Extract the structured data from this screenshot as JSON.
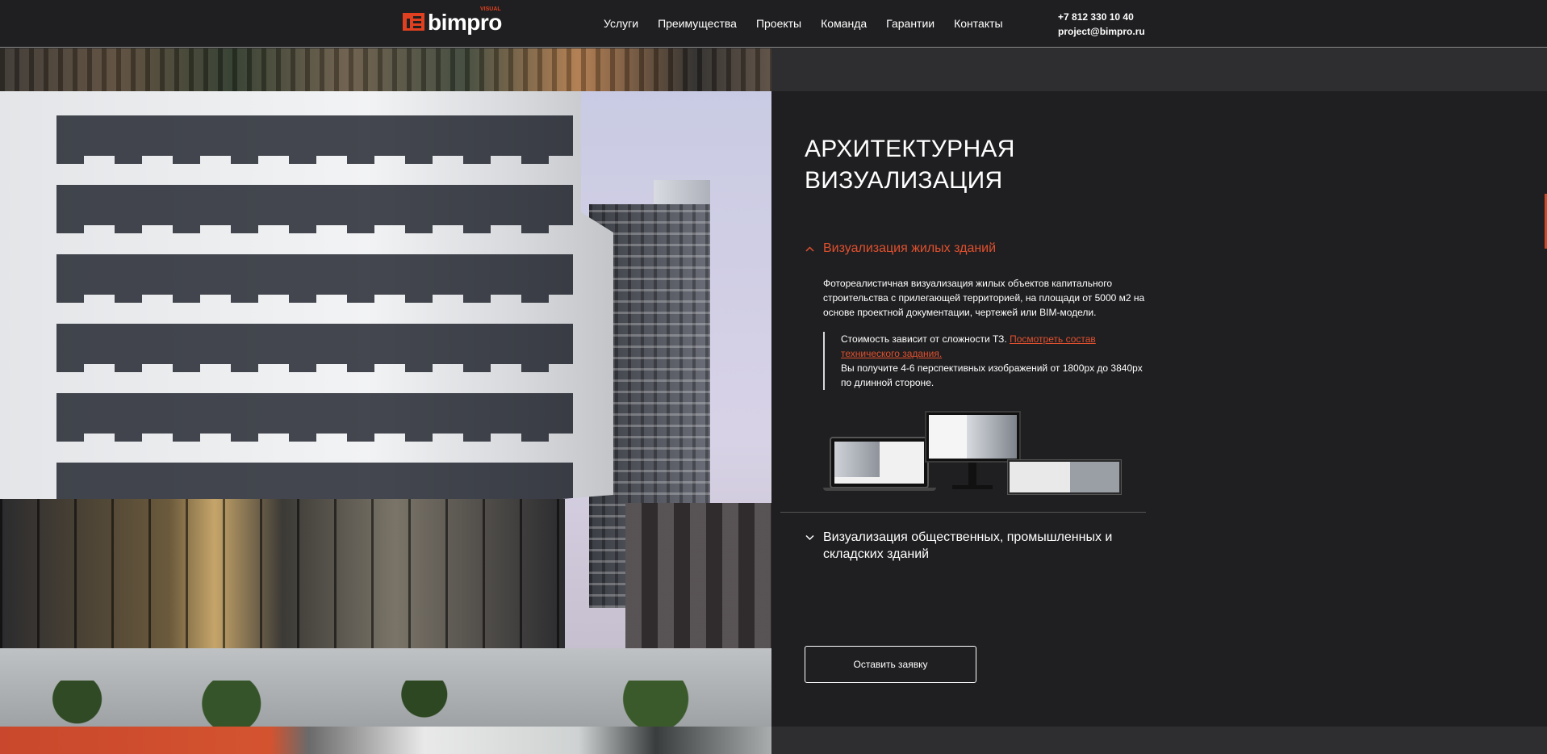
{
  "header": {
    "logo_text": "bimpro",
    "logo_tag": "VISUAL",
    "nav": [
      "Услуги",
      "Преимущества",
      "Проекты",
      "Команда",
      "Гарантии",
      "Контакты"
    ],
    "phone": "+7 812 330 10 40",
    "email": "project@bimpro.ru"
  },
  "section": {
    "title_line1": "АРХИТЕКТУРНАЯ",
    "title_line2": "ВИЗУАЛИЗАЦИЯ"
  },
  "accordion": [
    {
      "title": "Визуализация жилых зданий",
      "expanded": true,
      "description": "Фотореалистичная визуализация жилых объектов капитального строительства с прилегающей территорией, на площади от 5000 м2 на основе проектной документации, чертежей или BIM-модели.",
      "note_prefix": "Стоимость зависит от сложности ТЗ. ",
      "note_link": "Посмотреть состав технического задания.",
      "note_rest": "Вы получите 4-6 перспективных изображений от 1800px до 3840px по длинной стороне."
    },
    {
      "title": "Визуализация общественных, промышленных и складских зданий",
      "expanded": false
    }
  ],
  "cta": {
    "label": "Оставить заявку"
  },
  "colors": {
    "accent": "#e0502e",
    "panel": "#1f1f21",
    "header": "#1f1f21"
  },
  "icons": {
    "expanded": "chevron-up-icon",
    "collapsed": "chevron-down-icon"
  }
}
